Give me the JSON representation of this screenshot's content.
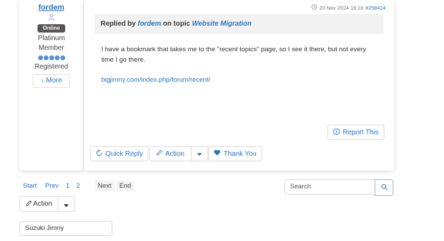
{
  "user": {
    "name": "fordem",
    "status_badge": "Online",
    "rank_line1": "Platinum",
    "rank_line2": "Member",
    "registered": "Registered",
    "more_label": "↓ More",
    "rank_dots": 5
  },
  "post": {
    "date": "20 Nov 2024 16:18",
    "post_id": "#258424",
    "replied_prefix": "Replied by",
    "replied_user": "fordem",
    "on_topic": "on topic",
    "topic": "Website Migration",
    "body": "I have a bookmark that takes me to the \"recent topics\" page, so I see it there, but not every time I go there.",
    "link": "bigjimny.com/index.php/forum/recent/",
    "report_label": "Report This",
    "quick_reply_label": "Quick Reply",
    "action_label": "Action",
    "thank_you_label": "Thank You"
  },
  "pagination": {
    "start": "Start",
    "prev": "Prev",
    "page1": "1",
    "page2": "2",
    "next": "Next",
    "end": "End"
  },
  "search": {
    "placeholder": "Search"
  },
  "bottom_action": {
    "label": "Action"
  },
  "bottom_field": {
    "value": "Suzuki Jimny"
  },
  "colors": {
    "link": "#2a74bd",
    "badge_bg": "#555555",
    "header_bg": "#f2f2f2",
    "rank_dot": "#5b8fd0"
  }
}
